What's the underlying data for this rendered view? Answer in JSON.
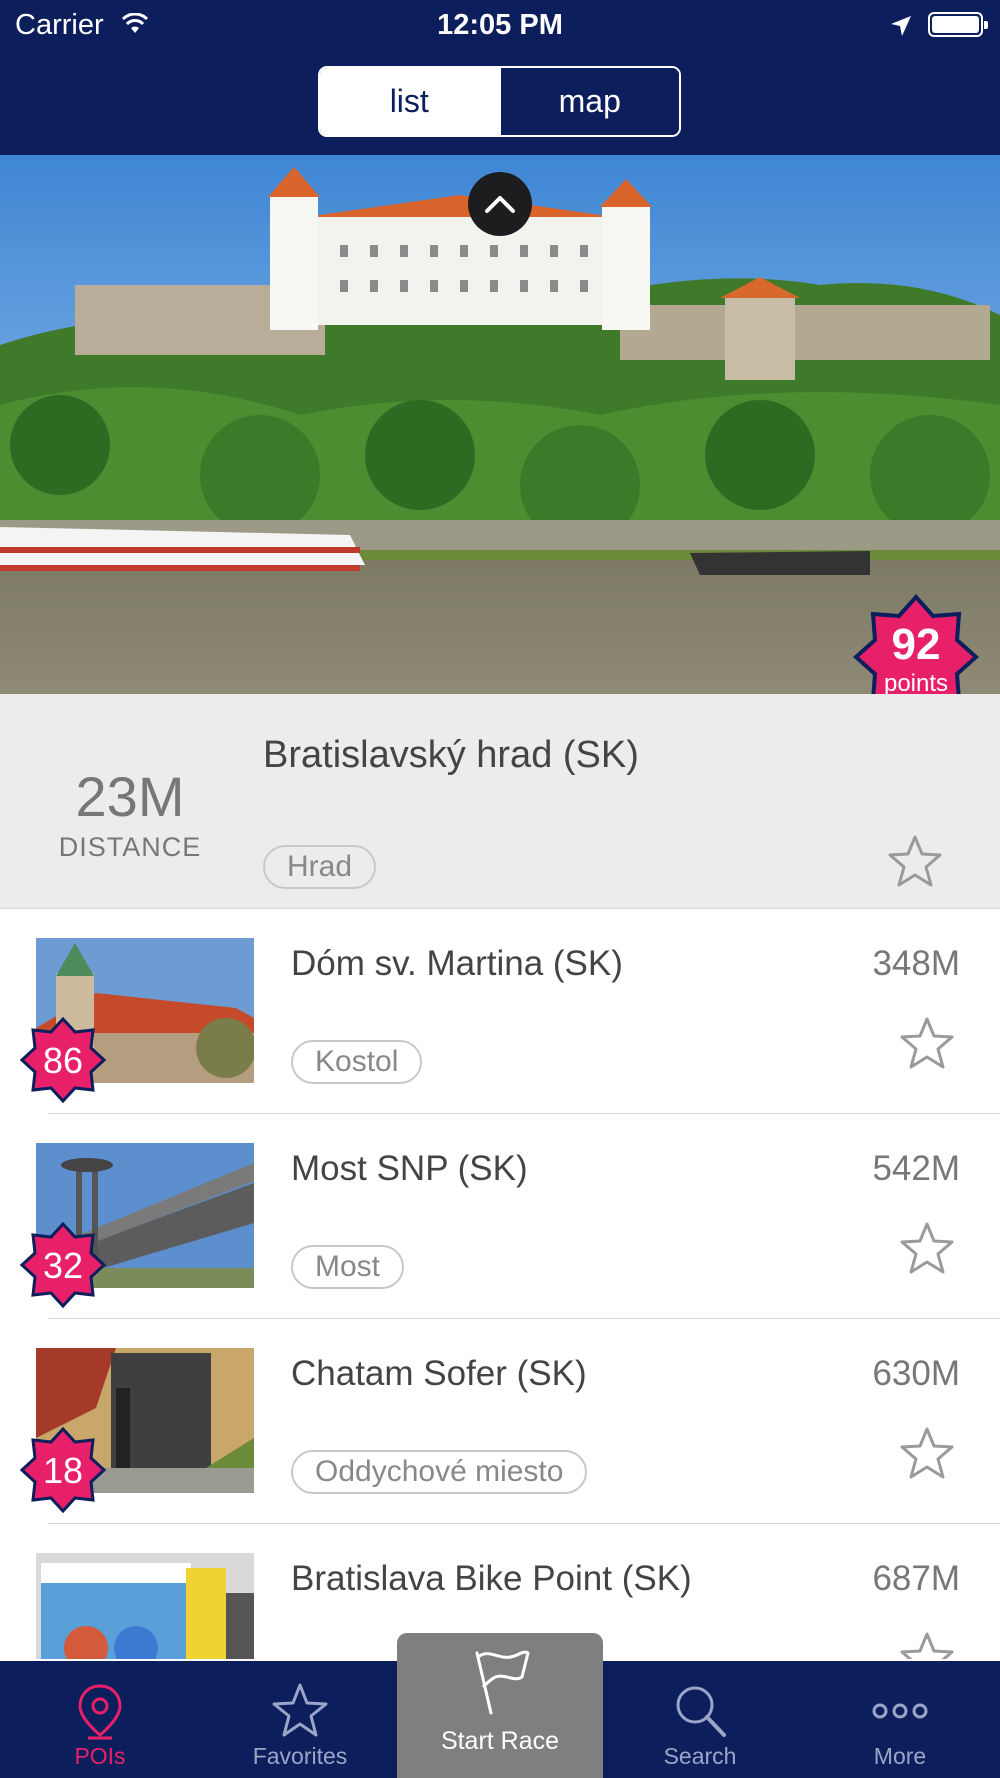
{
  "status_bar": {
    "carrier": "Carrier",
    "time": "12:05 PM"
  },
  "segment": {
    "list_label": "list",
    "map_label": "map",
    "selected": "list"
  },
  "featured": {
    "title": "Bratislavský hrad (SK)",
    "distance_value": "23M",
    "distance_label": "DISTANCE",
    "tag": "Hrad",
    "points_value": "92",
    "points_label": "points"
  },
  "pois": [
    {
      "title": "Dóm sv. Martina (SK)",
      "distance": "348M",
      "tag": "Kostol",
      "points": "86"
    },
    {
      "title": "Most SNP (SK)",
      "distance": "542M",
      "tag": "Most",
      "points": "32"
    },
    {
      "title": "Chatam Sofer (SK)",
      "distance": "630M",
      "tag": "Oddychové miesto",
      "points": "18"
    },
    {
      "title": "Bratislava Bike Point (SK)",
      "distance": "687M",
      "tag": "",
      "points": ""
    }
  ],
  "tabbar": {
    "pois_label": "POIs",
    "favorites_label": "Favorites",
    "start_race_label": "Start Race",
    "search_label": "Search",
    "more_label": "More",
    "active": "POIs"
  },
  "colors": {
    "navy": "#0c1f5c",
    "accent_pink": "#e8206a",
    "badge_border": "#0c1f5c"
  }
}
